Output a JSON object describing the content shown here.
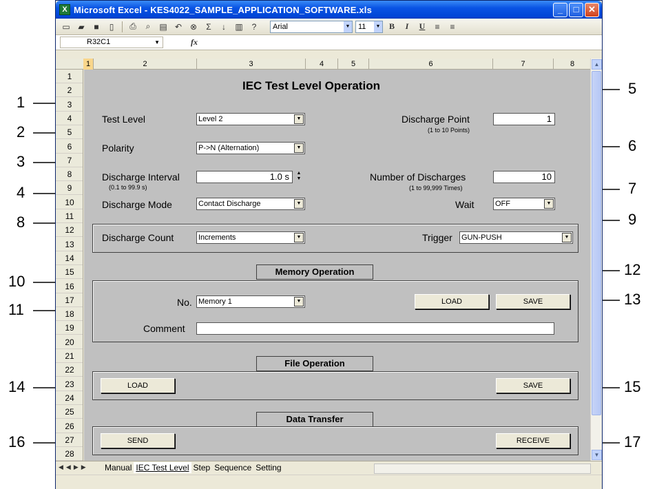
{
  "window": {
    "title": "Microsoft Excel - KES4022_SAMPLE_APPLICATION_SOFTWARE.xls",
    "min_label": "_",
    "max_label": "□",
    "close_label": "✕"
  },
  "toolbar": {
    "font": "Arial",
    "size": "11",
    "bold": "B",
    "italic": "I",
    "underline": "U"
  },
  "formula_bar": {
    "name_box": "R32C1",
    "fx": "fx"
  },
  "columns": [
    "1",
    "2",
    "3",
    "4",
    "5",
    "6",
    "7",
    "8"
  ],
  "rows": [
    "1",
    "2",
    "3",
    "4",
    "5",
    "6",
    "7",
    "8",
    "9",
    "10",
    "11",
    "12",
    "13",
    "14",
    "15",
    "16",
    "17",
    "18",
    "19",
    "20",
    "21",
    "22",
    "23",
    "24",
    "25",
    "26",
    "27",
    "28"
  ],
  "form": {
    "title": "IEC Test Level Operation",
    "test_level_label": "Test Level",
    "test_level_value": "Level 2",
    "polarity_label": "Polarity",
    "polarity_value": "P->N (Alternation)",
    "interval_label": "Discharge Interval",
    "interval_range": "(0.1 to 99.9 s)",
    "interval_value": "1.0 s",
    "mode_label": "Discharge Mode",
    "mode_value": "Contact Discharge",
    "point_label": "Discharge Point",
    "point_range": "(1 to 10 Points)",
    "point_value": "1",
    "num_label": "Number of Discharges",
    "num_range": "(1 to 99,999 Times)",
    "num_value": "10",
    "wait_label": "Wait",
    "wait_value": "OFF",
    "count_label": "Discharge Count",
    "count_value": "Increments",
    "trigger_label": "Trigger",
    "trigger_value": "GUN-PUSH",
    "memory_title": "Memory Operation",
    "no_label": "No.",
    "no_value": "Memory 1",
    "load_label": "LOAD",
    "save_label": "SAVE",
    "comment_label": "Comment",
    "comment_value": "",
    "file_title": "File Operation",
    "file_load_label": "LOAD",
    "file_save_label": "SAVE",
    "transfer_title": "Data Transfer",
    "send_label": "SEND",
    "receive_label": "RECEIVE"
  },
  "sheet_tabs": [
    "Manual",
    "IEC Test Level",
    "Step",
    "Sequence",
    "Setting"
  ],
  "callouts": [
    "1",
    "2",
    "3",
    "4",
    "5",
    "6",
    "7",
    "8",
    "9",
    "10",
    "11",
    "12",
    "13",
    "14",
    "15",
    "16",
    "17"
  ]
}
